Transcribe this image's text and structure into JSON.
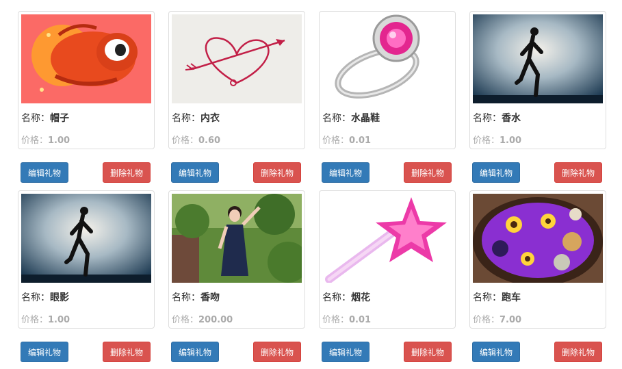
{
  "labels": {
    "name_prefix": "名称：",
    "price_prefix": "价格：",
    "edit_button": "编辑礼物",
    "delete_button": "删除礼物"
  },
  "gifts": [
    {
      "name": "帽子",
      "price": "1.00",
      "image": "cartoon-shrimp-image"
    },
    {
      "name": "内衣",
      "price": "0.60",
      "image": "heart-arrow-image"
    },
    {
      "name": "水晶鞋",
      "price": "0.01",
      "image": "diamond-ring-image"
    },
    {
      "name": "香水",
      "price": "1.00",
      "image": "runner-silhouette-image"
    },
    {
      "name": "眼影",
      "price": "1.00",
      "image": "runner-silhouette-image"
    },
    {
      "name": "香吻",
      "price": "200.00",
      "image": "woman-photo-image"
    },
    {
      "name": "烟花",
      "price": "0.01",
      "image": "star-wand-image"
    },
    {
      "name": "跑车",
      "price": "7.00",
      "image": "fruit-bowl-image"
    }
  ],
  "colors": {
    "edit_button": "#337ab7",
    "delete_button": "#d9534f",
    "price_text": "#aaaaaa"
  }
}
